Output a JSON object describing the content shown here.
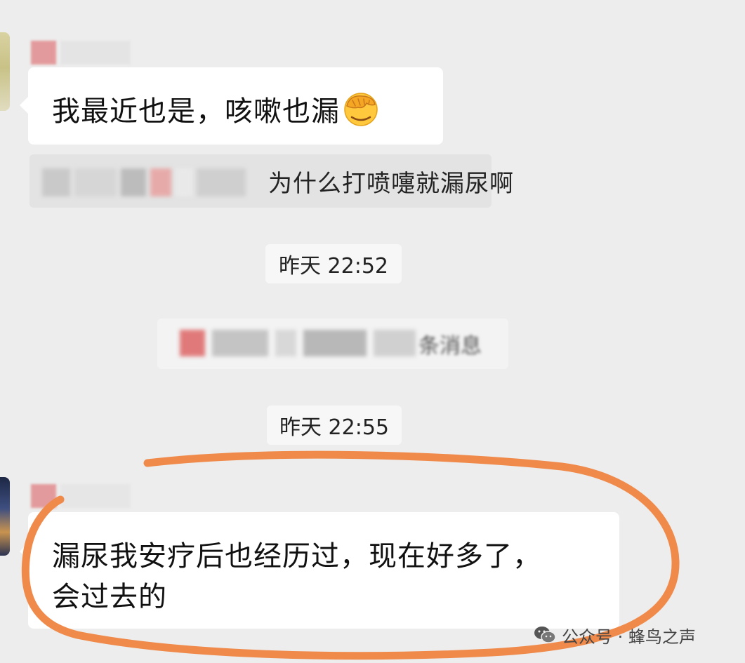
{
  "chat": {
    "message_1": {
      "text": "我最近也是，咳嗽也漏",
      "emoji": "facepalm-emoji"
    },
    "quote": {
      "text": "为什么打喷嚏就漏尿啊"
    },
    "timestamp_1": "昨天 22:52",
    "recalled_notice": {
      "text_tail": "条消息"
    },
    "timestamp_2": "昨天 22:55",
    "message_2": {
      "line_1": "漏尿我安疗后也经历过，现在好多了，",
      "line_2": "会过去的"
    }
  },
  "watermark": {
    "label": "公众号 · 蜂鸟之声",
    "icon": "wechat-icon"
  },
  "colors": {
    "background": "#ededed",
    "bubble": "#ffffff",
    "quote_background": "#e3e3e3",
    "timestamp_background": "#f7f7f7",
    "highlight_stroke": "#f08a4b"
  }
}
